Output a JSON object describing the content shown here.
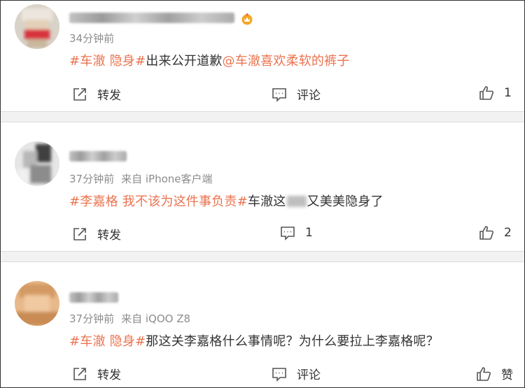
{
  "comments": [
    {
      "time": "34分钟前",
      "source": "",
      "tags": [
        "#车澈 隐身#"
      ],
      "body": "出来公开道歉",
      "mention": "@车澈喜欢柔软的裤子",
      "after_blur": "",
      "actions": {
        "repost": "转发",
        "comment": "评论",
        "like": "1"
      }
    },
    {
      "time": "37分钟前",
      "source": "来自 iPhone客户端",
      "tags": [
        "#李嘉格 我不该为这件事负责#"
      ],
      "body": "车澈这",
      "mention": "",
      "after_blur": "又美美隐身了",
      "actions": {
        "repost": "转发",
        "comment": "1",
        "like": "2"
      }
    },
    {
      "time": "37分钟前",
      "source": "来自 iQOO Z8",
      "tags": [
        "#车澈 隐身#"
      ],
      "body": "那这关李嘉格什么事情呢？为什么要拉上李嘉格呢？",
      "mention": "",
      "after_blur": "",
      "actions": {
        "repost": "转发",
        "comment": "评论",
        "like": "赞"
      }
    }
  ],
  "icons": {
    "repost": "repost-icon",
    "comment": "comment-icon",
    "like": "thumbs-up-icon",
    "vip": "vip-crown-badge-icon"
  },
  "colors": {
    "accent": "#eb7350",
    "meta": "#8c8c8c",
    "text": "#333333",
    "separator": "#f2f2f2"
  }
}
